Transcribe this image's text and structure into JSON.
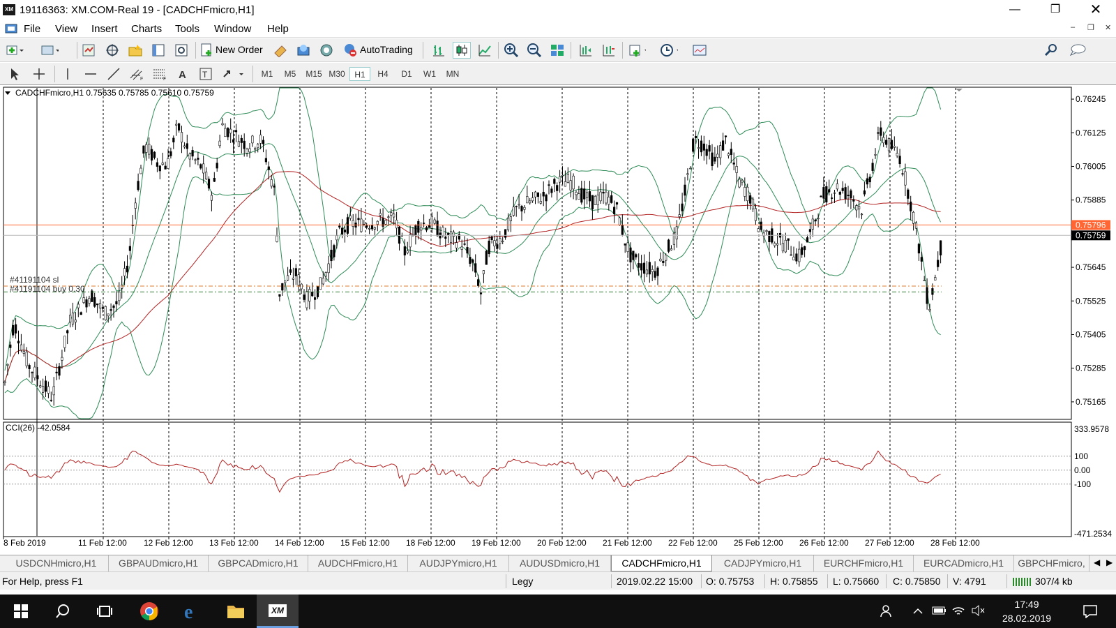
{
  "window": {
    "title": "19116363: XM.COM-Real 19 - [CADCHFmicro,H1]",
    "app_icon": "XM"
  },
  "menu": [
    "File",
    "View",
    "Insert",
    "Charts",
    "Tools",
    "Window",
    "Help"
  ],
  "toolbar": {
    "new_order": "New Order",
    "autotrading": "AutoTrading"
  },
  "timeframes": [
    "M1",
    "M5",
    "M15",
    "M30",
    "H1",
    "H4",
    "D1",
    "W1",
    "MN"
  ],
  "active_timeframe": "H1",
  "chart": {
    "header": "CADCHFmicro,H1  0.75635 0.75785 0.75610 0.75759",
    "price_labels": [
      "0.76245",
      "0.76125",
      "0.76005",
      "0.75885",
      "0.75645",
      "0.75525",
      "0.75405",
      "0.75285",
      "0.75165"
    ],
    "marker_orange": "0.75796",
    "marker_current": "0.75759",
    "order_sl": "#41191104 sl",
    "order_buy": "#41191104 buy 0.30",
    "cci_header": "CCI(26) -42.0584",
    "cci_labels": [
      "333.9578",
      "100",
      "0.00",
      "-100",
      "-471.2534"
    ],
    "date_labels": [
      "8 Feb 2019",
      "11 Feb 12:00",
      "12 Feb 12:00",
      "13 Feb 12:00",
      "14 Feb 12:00",
      "15 Feb 12:00",
      "18 Feb 12:00",
      "19 Feb 12:00",
      "20 Feb 12:00",
      "21 Feb 12:00",
      "22 Feb 12:00",
      "25 Feb 12:00",
      "26 Feb 12:00",
      "27 Feb 12:00",
      "28 Feb 12:00"
    ]
  },
  "tabs": [
    "USDCNHmicro,H1",
    "GBPAUDmicro,H1",
    "GBPCADmicro,H1",
    "AUDCHFmicro,H1",
    "AUDJPYmicro,H1",
    "AUDUSDmicro,H1",
    "CADCHFmicro,H1",
    "CADJPYmicro,H1",
    "EURCHFmicro,H1",
    "EURCADmicro,H1",
    "GBPCHFmicro,"
  ],
  "active_tab": "CADCHFmicro,H1",
  "status": {
    "help": "For Help, press F1",
    "profile": "Legy",
    "time": "2019.02.22 15:00",
    "open": "O: 0.75753",
    "high": "H: 0.75855",
    "low": "L: 0.75660",
    "close": "C: 0.75850",
    "volume": "V: 4791",
    "traffic": "307/4 kb"
  },
  "taskbar": {
    "time": "17:49",
    "date": "28.02.2019",
    "xm_label": "XM"
  },
  "colors": {
    "candle": "#000000",
    "bands": "#2e8b57",
    "ma": "#b22222",
    "cci": "#b22222",
    "order_orange": "#e07a2e",
    "order_green": "#2e7d32",
    "price_orange": "#ff6633"
  }
}
